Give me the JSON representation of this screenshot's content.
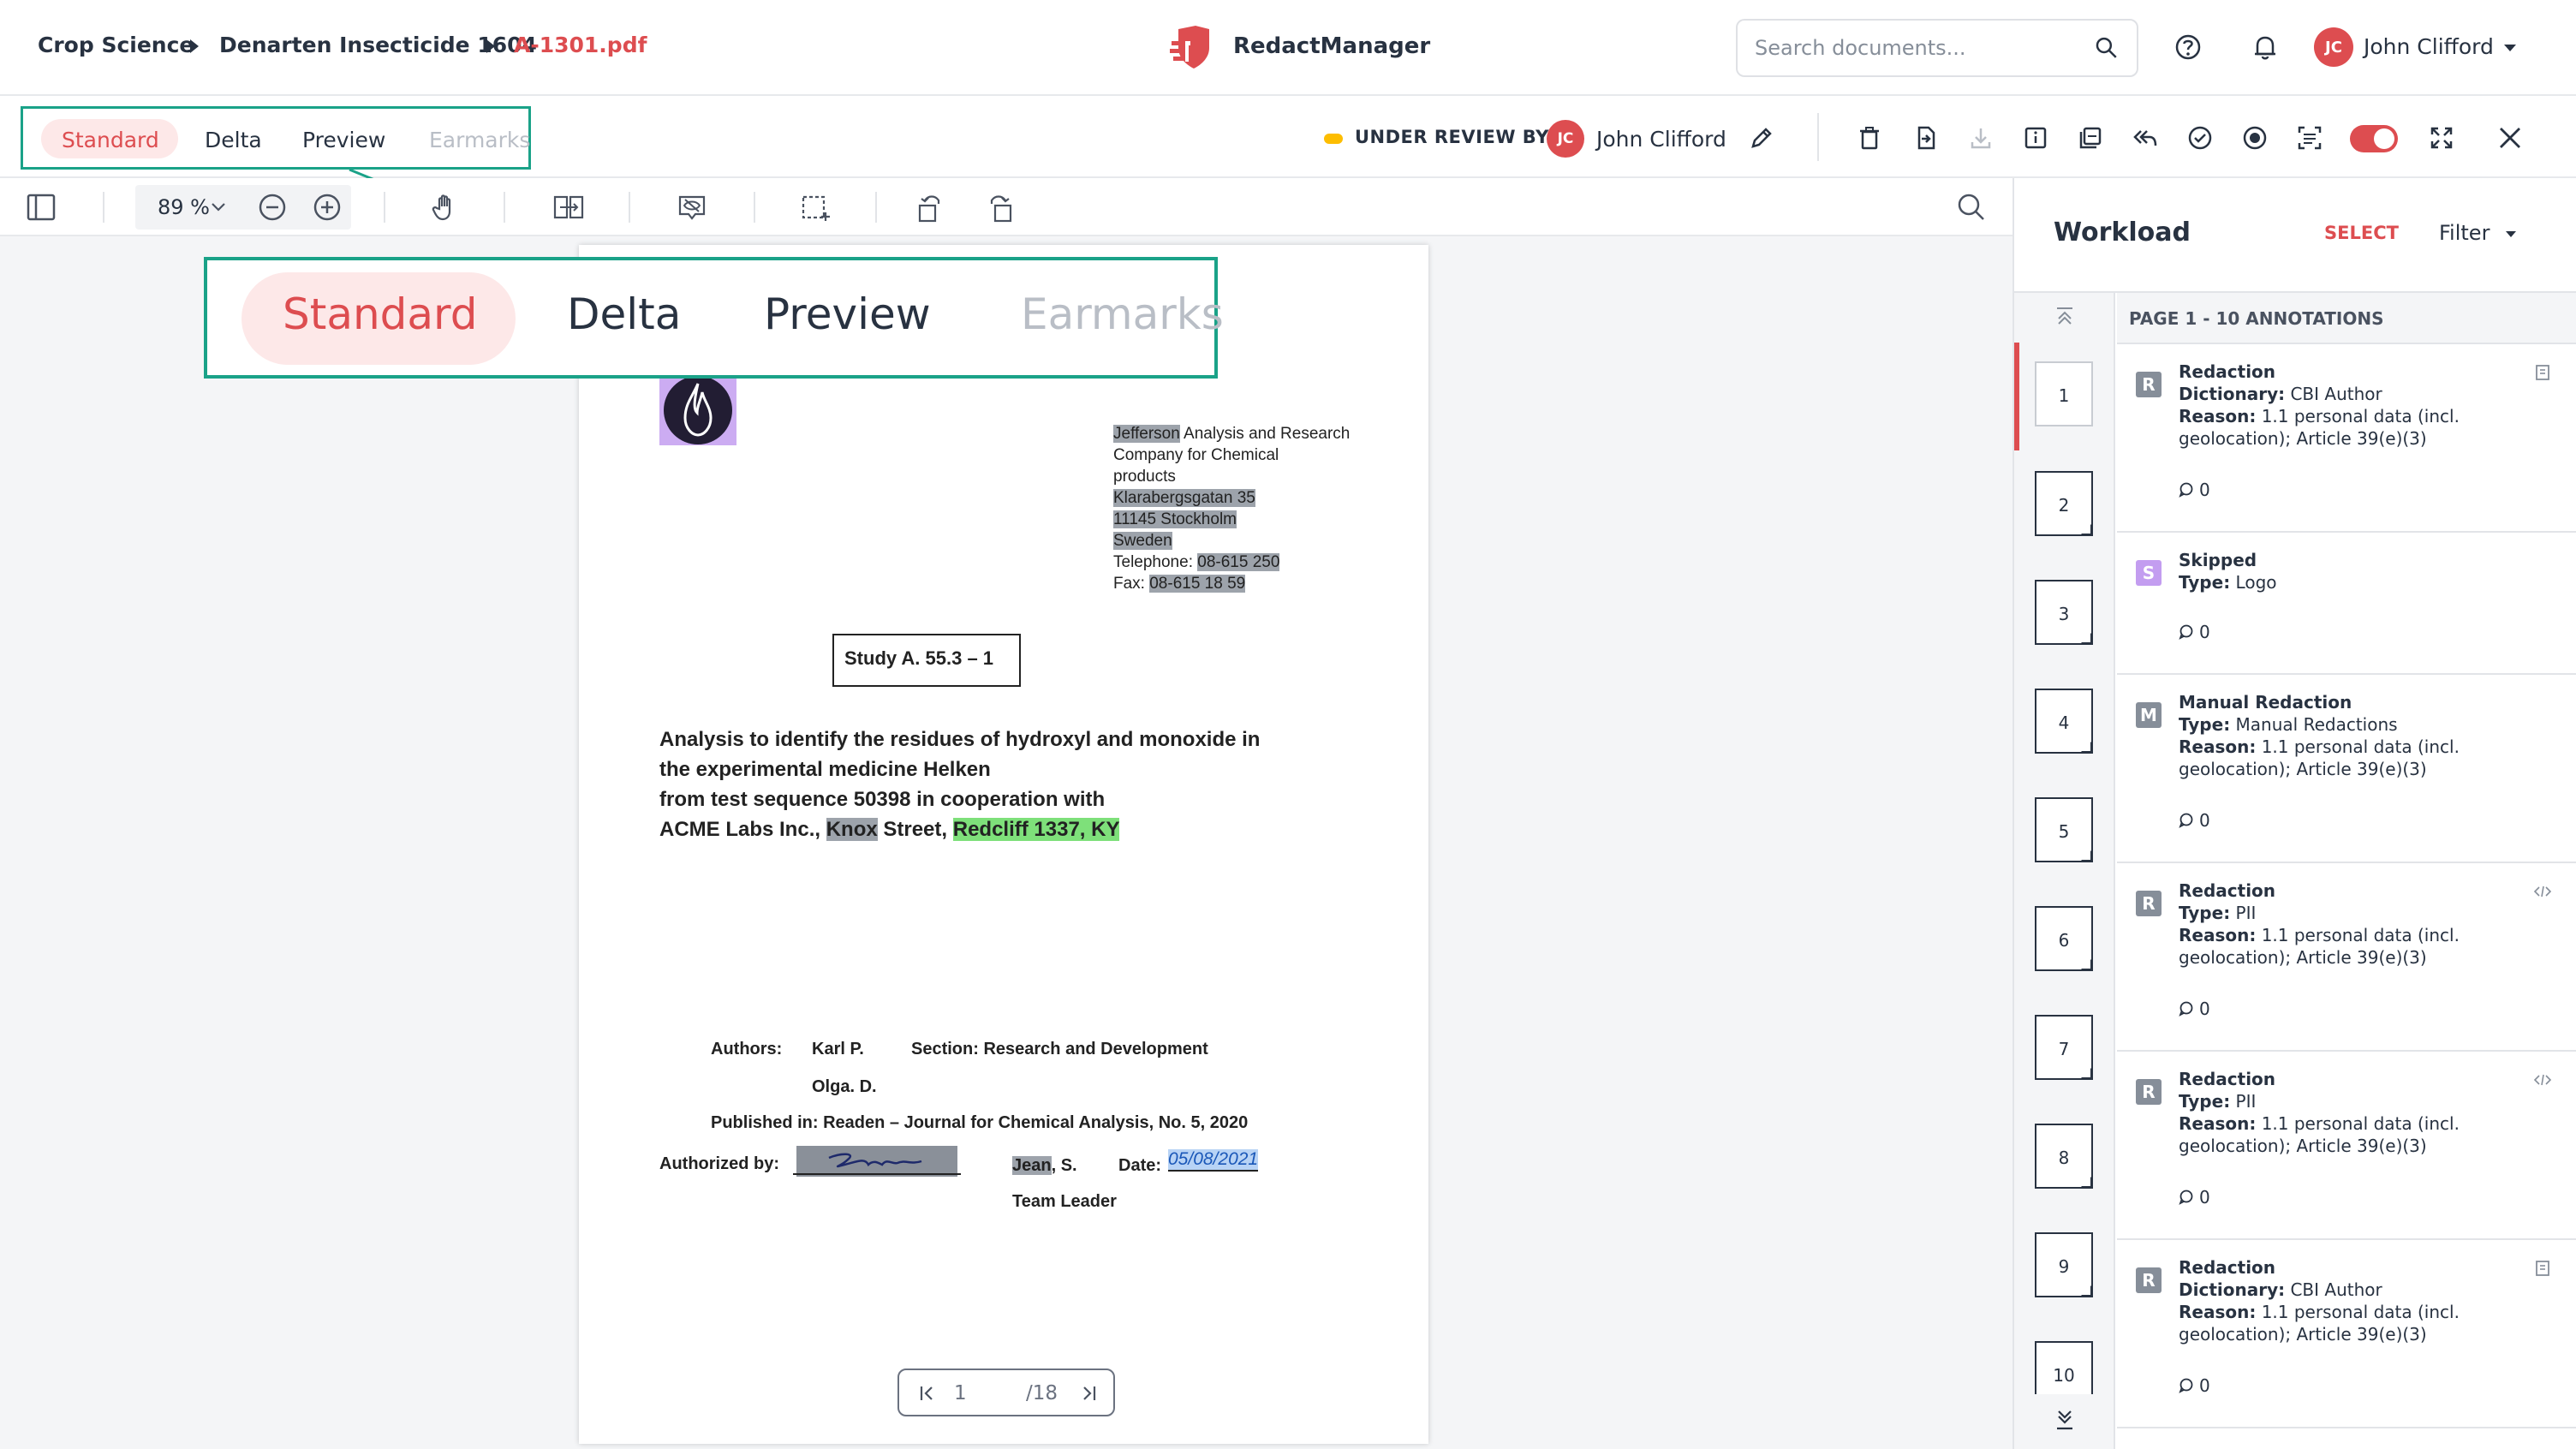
{
  "breadcrumb": {
    "items": [
      "Crop Science",
      "Denarten Insecticide 1604"
    ],
    "current": "A-1301.pdf"
  },
  "app": {
    "name": "RedactManager"
  },
  "search": {
    "placeholder": "Search documents..."
  },
  "user": {
    "initials": "JC",
    "name": "John Clifford"
  },
  "view_modes": {
    "items": [
      "Standard",
      "Delta",
      "Preview",
      "Earmarks"
    ],
    "active": "Standard"
  },
  "status": {
    "label": "UNDER REVIEW BY:",
    "reviewer_initials": "JC",
    "reviewer_name": "John Clifford"
  },
  "zoom": {
    "value": "89 %"
  },
  "document": {
    "address": [
      "Jefferson Analysis and Research",
      "Company for Chemical",
      "products",
      "Klarabergsgatan 35",
      "11145 Stockholm",
      "Sweden"
    ],
    "address_redacted_name": "Jefferson",
    "address_name_rest": " Analysis and Research",
    "telephone_label": "Telephone: ",
    "telephone": "08-615 250",
    "fax_label": "Fax: ",
    "fax": "08-615 18 59",
    "study": "Study A. 55.3 – 1",
    "title_lines": [
      "Analysis to identify the residues of hydroxyl and monoxide in",
      "the experimental medicine Helken",
      "from test sequence 50398 in cooperation with"
    ],
    "title_last_prefix": "ACME Labs Inc., ",
    "title_last_redacted": "Knox",
    "title_last_mid": " Street, ",
    "title_last_highlight": "Redcliff 1337, KY",
    "authors_label": "Authors:",
    "author_1": "Karl P.",
    "author_2": "Olga. D.",
    "section": "Section: Research and Development",
    "published": "Published in: Readen – Journal for Chemical Analysis, No. 5, 2020",
    "authorized_label": "Authorized by:",
    "signer_redacted": "Jean",
    "signer_rest": ", S.",
    "date_label": "Date:",
    "date_value": "05/08/2021",
    "team_leader": "Team Leader"
  },
  "pager": {
    "current": "1",
    "total": "/18"
  },
  "workload": {
    "title": "Workload",
    "select_label": "SELECT",
    "filter_label": "Filter",
    "page_header": "PAGE 1 - 10 ANNOTATIONS",
    "pages": [
      "1",
      "2",
      "3",
      "4",
      "5",
      "6",
      "7",
      "8",
      "9",
      "10"
    ],
    "annotations": [
      {
        "badge": "R",
        "title": "Redaction",
        "l1k": "Dictionary:",
        "l1v": " CBI Author",
        "l2k": "Reason:",
        "l2v": " 1.1 personal data (incl.",
        "l3": "geolocation); Article 39(e)(3)",
        "comments": "0"
      },
      {
        "badge": "S",
        "title": "Skipped",
        "l1k": "Type:",
        "l1v": " Logo",
        "comments": "0"
      },
      {
        "badge": "M",
        "title": "Manual Redaction",
        "l1k": "Type:",
        "l1v": " Manual Redactions",
        "l2k": "Reason:",
        "l2v": " 1.1 personal data (incl.",
        "l3": "geolocation); Article 39(e)(3)",
        "comments": "0"
      },
      {
        "badge": "R",
        "title": "Redaction",
        "l1k": "Type:",
        "l1v": " PII",
        "l2k": "Reason:",
        "l2v": " 1.1 personal data (incl.",
        "l3": "geolocation); Article 39(e)(3)",
        "comments": "0"
      },
      {
        "badge": "R",
        "title": "Redaction",
        "l1k": "Type:",
        "l1v": " PII",
        "l2k": "Reason:",
        "l2v": " 1.1 personal data (incl.",
        "l3": "geolocation); Article 39(e)(3)",
        "comments": "0"
      },
      {
        "badge": "R",
        "title": "Redaction",
        "l1k": "Dictionary:",
        "l1v": " CBI Author",
        "l2k": "Reason:",
        "l2v": " 1.1 personal data (incl.",
        "l3": "geolocation); Article 39(e)(3)",
        "comments": "0"
      }
    ]
  },
  "colors": {
    "accent": "#dd4d50",
    "highlight_teal": "#1aa288",
    "skipped": "#c39df0",
    "redaction_badge": "#868e99",
    "status_dot": "#fdbd00"
  }
}
